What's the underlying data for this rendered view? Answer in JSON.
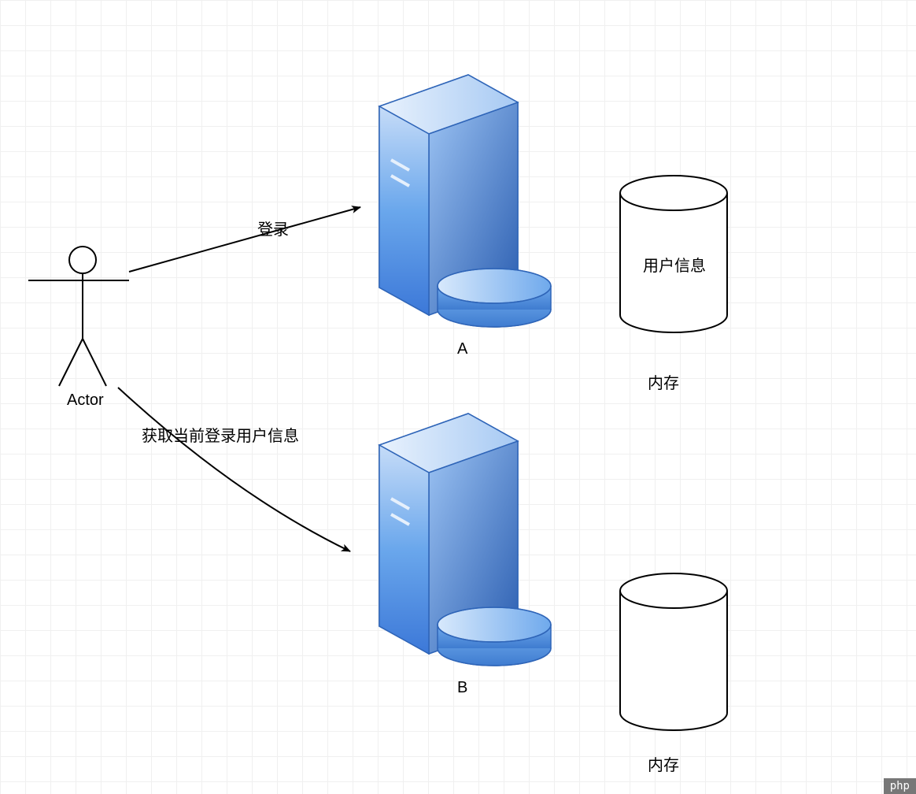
{
  "actor": {
    "label": "Actor"
  },
  "arrows": {
    "login": {
      "label": "登录"
    },
    "getUser": {
      "label": "获取当前登录用户信息"
    }
  },
  "servers": {
    "a": {
      "label": "A"
    },
    "b": {
      "label": "B"
    }
  },
  "cylinders": {
    "top": {
      "content": "用户信息",
      "caption": "内存"
    },
    "bottom": {
      "content": "",
      "caption": "内存"
    }
  },
  "watermark": "php"
}
